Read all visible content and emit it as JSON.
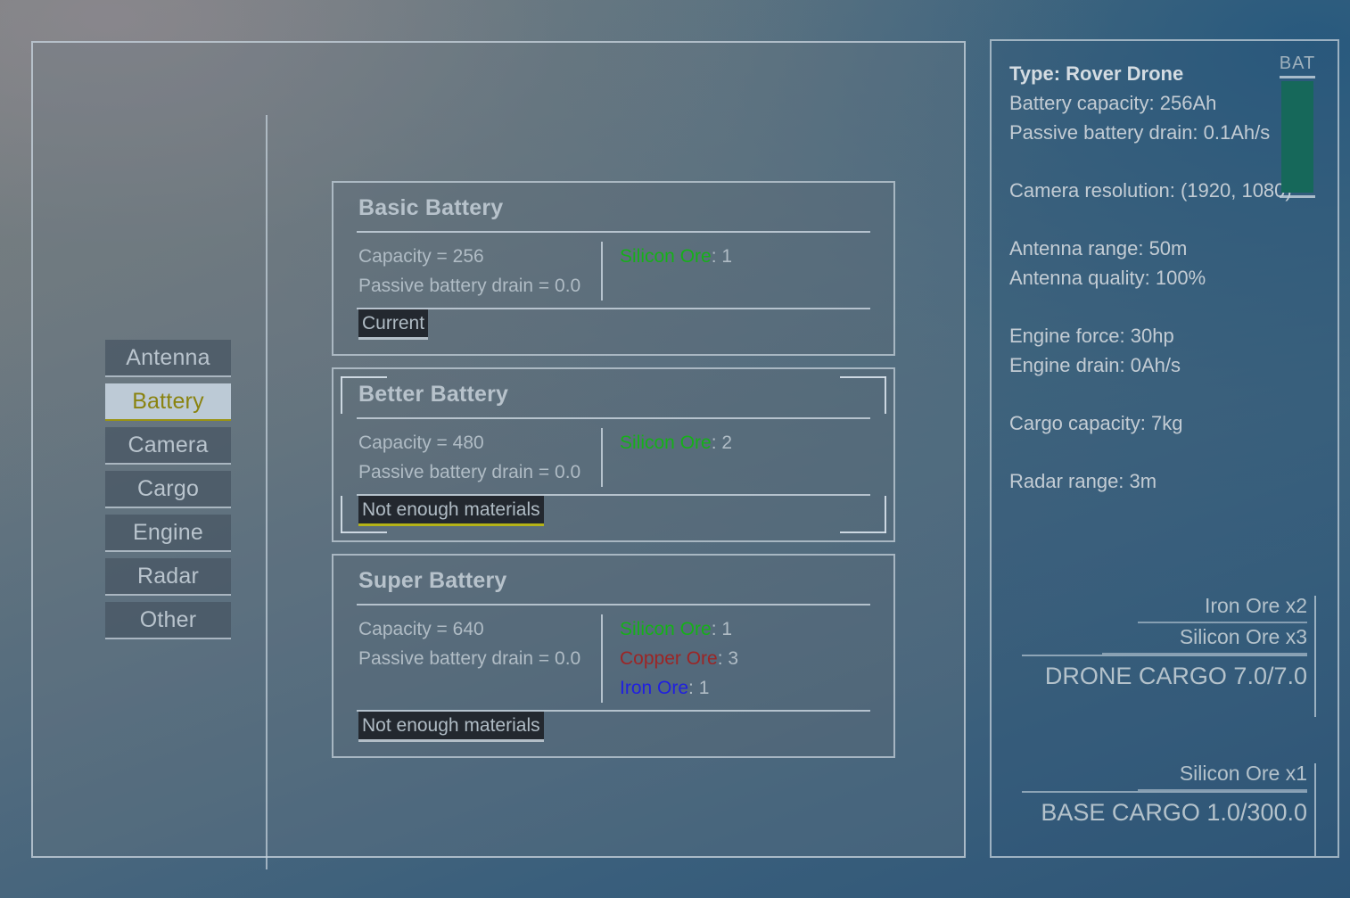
{
  "sidebar": {
    "items": [
      {
        "label": "Antenna",
        "active": false
      },
      {
        "label": "Battery",
        "active": true
      },
      {
        "label": "Camera",
        "active": false
      },
      {
        "label": "Cargo",
        "active": false
      },
      {
        "label": "Engine",
        "active": false
      },
      {
        "label": "Radar",
        "active": false
      },
      {
        "label": "Other",
        "active": false
      }
    ]
  },
  "cards": [
    {
      "title": "Basic Battery",
      "stats": [
        "Capacity = 256",
        "Passive battery drain = 0.0"
      ],
      "materials": [
        {
          "name": "Silicon Ore",
          "sep": ": ",
          "qty": "1",
          "color": "#16b019"
        }
      ],
      "status": "Current",
      "selected": false
    },
    {
      "title": "Better Battery",
      "stats": [
        "Capacity = 480",
        "Passive battery drain = 0.0"
      ],
      "materials": [
        {
          "name": "Silicon Ore",
          "sep": ": ",
          "qty": "2",
          "color": "#16b019"
        }
      ],
      "status": "Not enough materials",
      "selected": true
    },
    {
      "title": "Super Battery",
      "stats": [
        "Capacity = 640",
        "Passive battery drain = 0.0"
      ],
      "materials": [
        {
          "name": "Silicon Ore",
          "sep": ": ",
          "qty": "1",
          "color": "#16b019"
        },
        {
          "name": "Copper Ore",
          "sep": ": ",
          "qty": "3",
          "color": "#9c2525"
        },
        {
          "name": "Iron Ore",
          "sep": ": ",
          "qty": "1",
          "color": "#2020e0"
        }
      ],
      "status": "Not enough materials",
      "selected": false
    }
  ],
  "info": {
    "type_line": "Type: Rover Drone",
    "battery_capacity": "Battery capacity: 256Ah",
    "passive_drain": "Passive battery drain: 0.1Ah/s",
    "camera_resolution": "Camera resolution: (1920, 1080)",
    "antenna_range": "Antenna range: 50m",
    "antenna_quality": "Antenna quality: 100%",
    "engine_force": "Engine force: 30hp",
    "engine_drain": "Engine drain: 0Ah/s",
    "cargo_capacity": "Cargo capacity: 7kg",
    "radar_range": "Radar range: 3m",
    "battery_gauge": {
      "label": "BAT",
      "percent": 100,
      "fill_color": "#16685a"
    }
  },
  "drone_cargo": {
    "items": [
      "Iron Ore x2",
      "Silicon Ore x3"
    ],
    "total": "DRONE CARGO 7.0/7.0"
  },
  "base_cargo": {
    "items": [
      "Silicon Ore x1"
    ],
    "total": "BASE CARGO 1.0/300.0"
  }
}
